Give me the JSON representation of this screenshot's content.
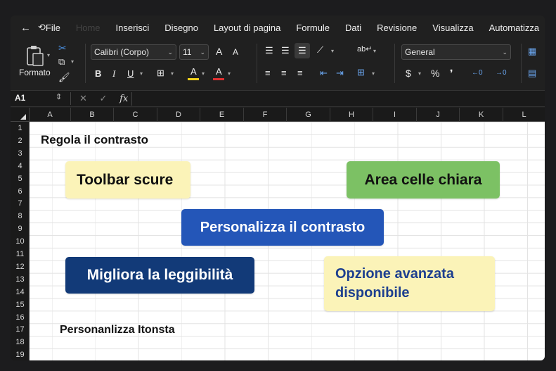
{
  "menu": {
    "items": [
      "File",
      "Home",
      "Inserisci",
      "Disegno",
      "Layout di pagina",
      "Formule",
      "Dati",
      "Revisione",
      "Visualizza",
      "Automatizza"
    ]
  },
  "ribbon": {
    "paste_label": "Formato",
    "font_name": "Calibri (Corpo)",
    "font_size": "11",
    "grow_font": "A",
    "shrink_font": "A",
    "bold": "B",
    "italic": "I",
    "underline": "U",
    "font_color_glyph": "A",
    "highlight_glyph": "A",
    "number_format": "General",
    "currency": "$",
    "percent": "%",
    "comma": "❜",
    "highlight_color": "#f2d21b",
    "font_color": "#e03030"
  },
  "formula_bar": {
    "name_box": "A1",
    "cancel_glyph": "✕",
    "confirm_glyph": "✓",
    "fx_glyph": "fx"
  },
  "columns": [
    "A",
    "B",
    "C",
    "D",
    "E",
    "F",
    "G",
    "H",
    "I",
    "J",
    "K",
    "L"
  ],
  "rows": [
    "1",
    "2",
    "3",
    "4",
    "5",
    "6",
    "7",
    "8",
    "9",
    "10",
    "11",
    "12",
    "13",
    "14",
    "15",
    "16",
    "17",
    "18",
    "19"
  ],
  "sheet": {
    "title": "Regola il contrasto",
    "footer": "Personanlizza Itonsta",
    "callouts": {
      "dark_toolbar": {
        "text": "Toolbar scure",
        "bg": "#fbf3b8",
        "fg": "#111111"
      },
      "light_cells": {
        "text": "Area celle chiara",
        "bg": "#7cc164",
        "fg": "#111111"
      },
      "customize": {
        "text": "Personalizza il contrasto",
        "bg": "#2456b8",
        "fg": "#ffffff"
      },
      "readability": {
        "text": "Migliora la leggibilità",
        "bg": "#123a78",
        "fg": "#ffffff"
      },
      "advanced": {
        "text": "Opzione avanzata disponibile",
        "bg": "#fbf3b8",
        "fg": "#1d3f8f"
      }
    }
  }
}
